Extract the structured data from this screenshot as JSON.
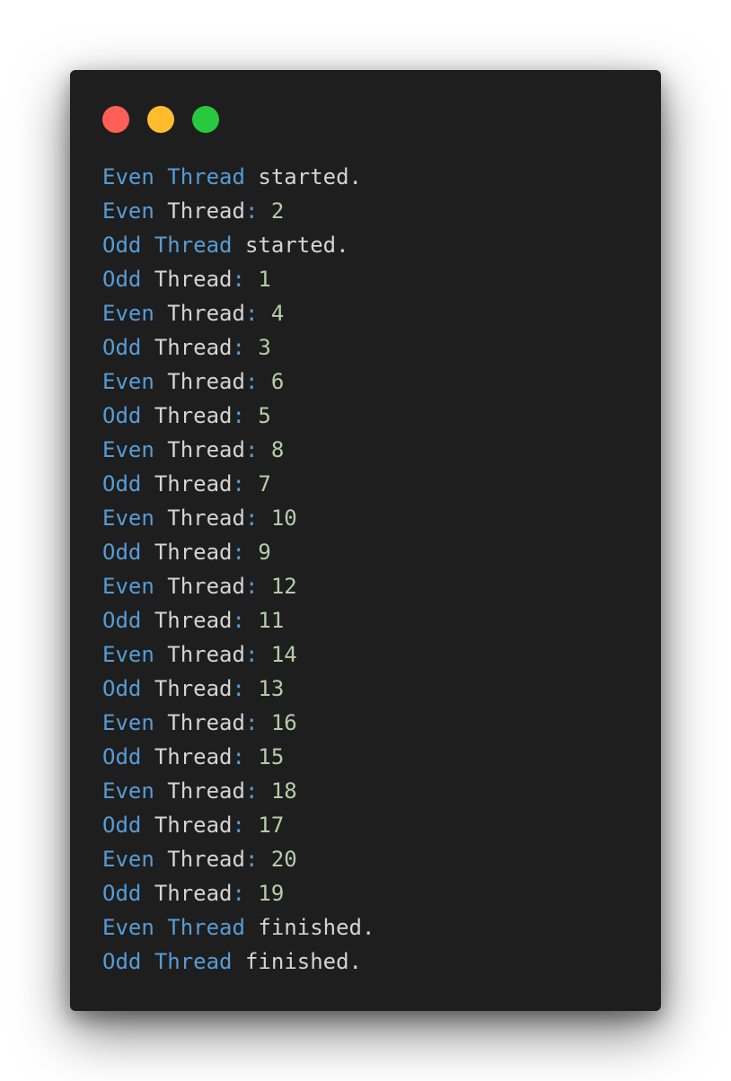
{
  "window": {
    "controls": [
      {
        "name": "close-dot",
        "color": "#ff5f56"
      },
      {
        "name": "minimize-dot",
        "color": "#ffbd2e"
      },
      {
        "name": "maximize-dot",
        "color": "#27c93f"
      }
    ]
  },
  "colors": {
    "background": "#1e1e1e",
    "keyword": "#569cd6",
    "text": "#d4d4d4",
    "number": "#b5cea8"
  },
  "output": {
    "lines": [
      {
        "who": "Even",
        "thread": "Thread",
        "rest": " started."
      },
      {
        "who": "Even",
        "thread": "Thread",
        "colon": ":",
        "value": "2"
      },
      {
        "who": "Odd",
        "thread": "Thread",
        "rest": " started."
      },
      {
        "who": "Odd",
        "thread": "Thread",
        "colon": ":",
        "value": "1"
      },
      {
        "who": "Even",
        "thread": "Thread",
        "colon": ":",
        "value": "4"
      },
      {
        "who": "Odd",
        "thread": "Thread",
        "colon": ":",
        "value": "3"
      },
      {
        "who": "Even",
        "thread": "Thread",
        "colon": ":",
        "value": "6"
      },
      {
        "who": "Odd",
        "thread": "Thread",
        "colon": ":",
        "value": "5"
      },
      {
        "who": "Even",
        "thread": "Thread",
        "colon": ":",
        "value": "8"
      },
      {
        "who": "Odd",
        "thread": "Thread",
        "colon": ":",
        "value": "7"
      },
      {
        "who": "Even",
        "thread": "Thread",
        "colon": ":",
        "value": "10"
      },
      {
        "who": "Odd",
        "thread": "Thread",
        "colon": ":",
        "value": "9"
      },
      {
        "who": "Even",
        "thread": "Thread",
        "colon": ":",
        "value": "12"
      },
      {
        "who": "Odd",
        "thread": "Thread",
        "colon": ":",
        "value": "11"
      },
      {
        "who": "Even",
        "thread": "Thread",
        "colon": ":",
        "value": "14"
      },
      {
        "who": "Odd",
        "thread": "Thread",
        "colon": ":",
        "value": "13"
      },
      {
        "who": "Even",
        "thread": "Thread",
        "colon": ":",
        "value": "16"
      },
      {
        "who": "Odd",
        "thread": "Thread",
        "colon": ":",
        "value": "15"
      },
      {
        "who": "Even",
        "thread": "Thread",
        "colon": ":",
        "value": "18"
      },
      {
        "who": "Odd",
        "thread": "Thread",
        "colon": ":",
        "value": "17"
      },
      {
        "who": "Even",
        "thread": "Thread",
        "colon": ":",
        "value": "20"
      },
      {
        "who": "Odd",
        "thread": "Thread",
        "colon": ":",
        "value": "19"
      },
      {
        "who": "Even",
        "thread": "Thread",
        "rest": " finished."
      },
      {
        "who": "Odd",
        "thread": "Thread",
        "rest": " finished."
      }
    ]
  }
}
